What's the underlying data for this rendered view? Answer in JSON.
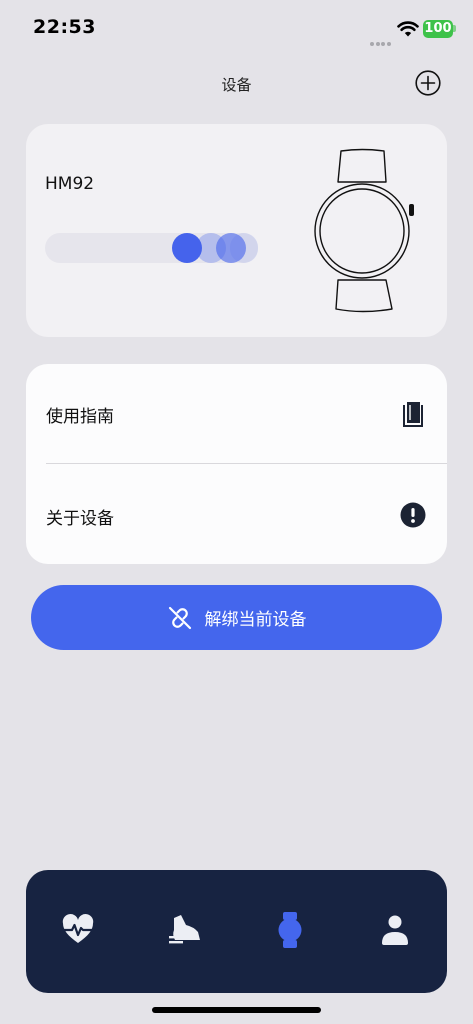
{
  "status_bar": {
    "time": "22:53",
    "battery": "100"
  },
  "header": {
    "title": "设备"
  },
  "device": {
    "model": "HM92"
  },
  "menu": {
    "items": [
      {
        "label": "使用指南",
        "icon": "book-icon"
      },
      {
        "label": "关于设备",
        "icon": "info-icon"
      }
    ]
  },
  "unbind": {
    "label": "解绑当前设备",
    "icon": "unlink-icon"
  },
  "tabbar": {
    "tabs": [
      {
        "icon": "heart-pulse-icon",
        "active": false
      },
      {
        "icon": "shoe-icon",
        "active": false
      },
      {
        "icon": "watch-icon",
        "active": true
      },
      {
        "icon": "user-icon",
        "active": false
      }
    ]
  },
  "colors": {
    "accent": "#4466ed",
    "tabbar": "#172341",
    "background": "#e4e3e8",
    "battery": "#3ec24a"
  }
}
